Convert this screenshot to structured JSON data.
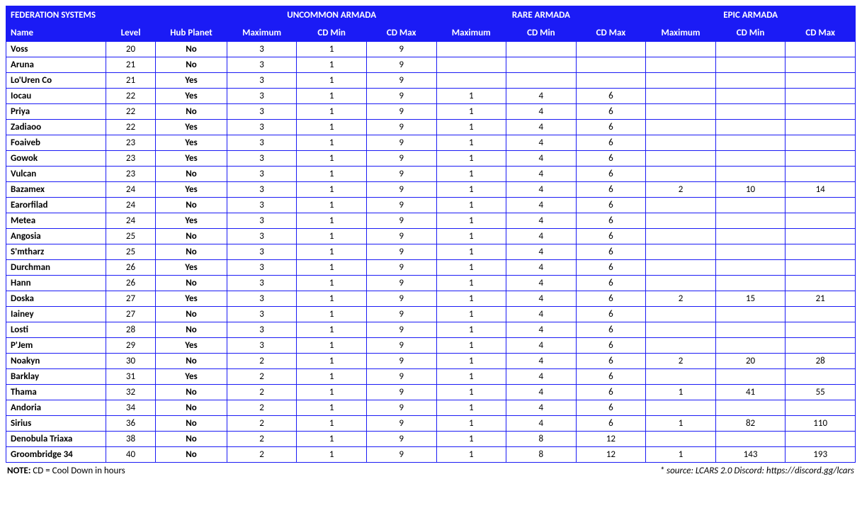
{
  "header": {
    "title": "FEDERATION SYSTEMS",
    "group_uncommon": "UNCOMMON ARMADA",
    "group_rare": "RARE ARMADA",
    "group_epic": "EPIC ARMADA",
    "col_name": "Name",
    "col_level": "Level",
    "col_hub": "Hub Planet",
    "col_max": "Maximum",
    "col_cdmin": "CD Min",
    "col_cdmax": "CD Max"
  },
  "rows": [
    {
      "name": "Voss",
      "level": "20",
      "hub": "No",
      "u_max": "3",
      "u_min": "1",
      "u_maxcd": "9",
      "r_max": "",
      "r_min": "",
      "r_maxcd": "",
      "e_max": "",
      "e_min": "",
      "e_maxcd": ""
    },
    {
      "name": "Aruna",
      "level": "21",
      "hub": "No",
      "u_max": "3",
      "u_min": "1",
      "u_maxcd": "9",
      "r_max": "",
      "r_min": "",
      "r_maxcd": "",
      "e_max": "",
      "e_min": "",
      "e_maxcd": ""
    },
    {
      "name": "Lo'Uren Co",
      "level": "21",
      "hub": "Yes",
      "u_max": "3",
      "u_min": "1",
      "u_maxcd": "9",
      "r_max": "",
      "r_min": "",
      "r_maxcd": "",
      "e_max": "",
      "e_min": "",
      "e_maxcd": ""
    },
    {
      "name": "Iocau",
      "level": "22",
      "hub": "Yes",
      "u_max": "3",
      "u_min": "1",
      "u_maxcd": "9",
      "r_max": "1",
      "r_min": "4",
      "r_maxcd": "6",
      "e_max": "",
      "e_min": "",
      "e_maxcd": ""
    },
    {
      "name": "Priya",
      "level": "22",
      "hub": "No",
      "u_max": "3",
      "u_min": "1",
      "u_maxcd": "9",
      "r_max": "1",
      "r_min": "4",
      "r_maxcd": "6",
      "e_max": "",
      "e_min": "",
      "e_maxcd": ""
    },
    {
      "name": "Zadiaoo",
      "level": "22",
      "hub": "Yes",
      "u_max": "3",
      "u_min": "1",
      "u_maxcd": "9",
      "r_max": "1",
      "r_min": "4",
      "r_maxcd": "6",
      "e_max": "",
      "e_min": "",
      "e_maxcd": ""
    },
    {
      "name": "Foaiveb",
      "level": "23",
      "hub": "Yes",
      "u_max": "3",
      "u_min": "1",
      "u_maxcd": "9",
      "r_max": "1",
      "r_min": "4",
      "r_maxcd": "6",
      "e_max": "",
      "e_min": "",
      "e_maxcd": ""
    },
    {
      "name": "Gowok",
      "level": "23",
      "hub": "Yes",
      "u_max": "3",
      "u_min": "1",
      "u_maxcd": "9",
      "r_max": "1",
      "r_min": "4",
      "r_maxcd": "6",
      "e_max": "",
      "e_min": "",
      "e_maxcd": ""
    },
    {
      "name": "Vulcan",
      "level": "23",
      "hub": "No",
      "u_max": "3",
      "u_min": "1",
      "u_maxcd": "9",
      "r_max": "1",
      "r_min": "4",
      "r_maxcd": "6",
      "e_max": "",
      "e_min": "",
      "e_maxcd": ""
    },
    {
      "name": "Bazamex",
      "level": "24",
      "hub": "Yes",
      "u_max": "3",
      "u_min": "1",
      "u_maxcd": "9",
      "r_max": "1",
      "r_min": "4",
      "r_maxcd": "6",
      "e_max": "2",
      "e_min": "10",
      "e_maxcd": "14"
    },
    {
      "name": "Earorfilad",
      "level": "24",
      "hub": "No",
      "u_max": "3",
      "u_min": "1",
      "u_maxcd": "9",
      "r_max": "1",
      "r_min": "4",
      "r_maxcd": "6",
      "e_max": "",
      "e_min": "",
      "e_maxcd": ""
    },
    {
      "name": "Metea",
      "level": "24",
      "hub": "Yes",
      "u_max": "3",
      "u_min": "1",
      "u_maxcd": "9",
      "r_max": "1",
      "r_min": "4",
      "r_maxcd": "6",
      "e_max": "",
      "e_min": "",
      "e_maxcd": ""
    },
    {
      "name": "Angosia",
      "level": "25",
      "hub": "No",
      "u_max": "3",
      "u_min": "1",
      "u_maxcd": "9",
      "r_max": "1",
      "r_min": "4",
      "r_maxcd": "6",
      "e_max": "",
      "e_min": "",
      "e_maxcd": ""
    },
    {
      "name": "S'mtharz",
      "level": "25",
      "hub": "No",
      "u_max": "3",
      "u_min": "1",
      "u_maxcd": "9",
      "r_max": "1",
      "r_min": "4",
      "r_maxcd": "6",
      "e_max": "",
      "e_min": "",
      "e_maxcd": ""
    },
    {
      "name": "Durchman",
      "level": "26",
      "hub": "Yes",
      "u_max": "3",
      "u_min": "1",
      "u_maxcd": "9",
      "r_max": "1",
      "r_min": "4",
      "r_maxcd": "6",
      "e_max": "",
      "e_min": "",
      "e_maxcd": ""
    },
    {
      "name": "Hann",
      "level": "26",
      "hub": "No",
      "u_max": "3",
      "u_min": "1",
      "u_maxcd": "9",
      "r_max": "1",
      "r_min": "4",
      "r_maxcd": "6",
      "e_max": "",
      "e_min": "",
      "e_maxcd": ""
    },
    {
      "name": "Doska",
      "level": "27",
      "hub": "Yes",
      "u_max": "3",
      "u_min": "1",
      "u_maxcd": "9",
      "r_max": "1",
      "r_min": "4",
      "r_maxcd": "6",
      "e_max": "2",
      "e_min": "15",
      "e_maxcd": "21"
    },
    {
      "name": "Iainey",
      "level": "27",
      "hub": "No",
      "u_max": "3",
      "u_min": "1",
      "u_maxcd": "9",
      "r_max": "1",
      "r_min": "4",
      "r_maxcd": "6",
      "e_max": "",
      "e_min": "",
      "e_maxcd": ""
    },
    {
      "name": "Losti",
      "level": "28",
      "hub": "No",
      "u_max": "3",
      "u_min": "1",
      "u_maxcd": "9",
      "r_max": "1",
      "r_min": "4",
      "r_maxcd": "6",
      "e_max": "",
      "e_min": "",
      "e_maxcd": ""
    },
    {
      "name": "P'Jem",
      "level": "29",
      "hub": "Yes",
      "u_max": "3",
      "u_min": "1",
      "u_maxcd": "9",
      "r_max": "1",
      "r_min": "4",
      "r_maxcd": "6",
      "e_max": "",
      "e_min": "",
      "e_maxcd": ""
    },
    {
      "name": "Noakyn",
      "level": "30",
      "hub": "No",
      "u_max": "2",
      "u_min": "1",
      "u_maxcd": "9",
      "r_max": "1",
      "r_min": "4",
      "r_maxcd": "6",
      "e_max": "2",
      "e_min": "20",
      "e_maxcd": "28"
    },
    {
      "name": "Barklay",
      "level": "31",
      "hub": "Yes",
      "u_max": "2",
      "u_min": "1",
      "u_maxcd": "9",
      "r_max": "1",
      "r_min": "4",
      "r_maxcd": "6",
      "e_max": "",
      "e_min": "",
      "e_maxcd": ""
    },
    {
      "name": "Thama",
      "level": "32",
      "hub": "No",
      "u_max": "2",
      "u_min": "1",
      "u_maxcd": "9",
      "r_max": "1",
      "r_min": "4",
      "r_maxcd": "6",
      "e_max": "1",
      "e_min": "41",
      "e_maxcd": "55"
    },
    {
      "name": "Andoria",
      "level": "34",
      "hub": "No",
      "u_max": "2",
      "u_min": "1",
      "u_maxcd": "9",
      "r_max": "1",
      "r_min": "4",
      "r_maxcd": "6",
      "e_max": "",
      "e_min": "",
      "e_maxcd": ""
    },
    {
      "name": "Sirius",
      "level": "36",
      "hub": "No",
      "u_max": "2",
      "u_min": "1",
      "u_maxcd": "9",
      "r_max": "1",
      "r_min": "4",
      "r_maxcd": "6",
      "e_max": "1",
      "e_min": "82",
      "e_maxcd": "110"
    },
    {
      "name": "Denobula Triaxa",
      "level": "38",
      "hub": "No",
      "u_max": "2",
      "u_min": "1",
      "u_maxcd": "9",
      "r_max": "1",
      "r_min": "8",
      "r_maxcd": "12",
      "e_max": "",
      "e_min": "",
      "e_maxcd": ""
    },
    {
      "name": "Groombridge 34",
      "level": "40",
      "hub": "No",
      "u_max": "2",
      "u_min": "1",
      "u_maxcd": "9",
      "r_max": "1",
      "r_min": "8",
      "r_maxcd": "12",
      "e_max": "1",
      "e_min": "143",
      "e_maxcd": "193"
    }
  ],
  "footer": {
    "note_label": "NOTE:",
    "note_text": " CD = Cool Down in hours",
    "source": "* source: LCARS 2.0 Discord: https://discord.gg/lcars"
  }
}
